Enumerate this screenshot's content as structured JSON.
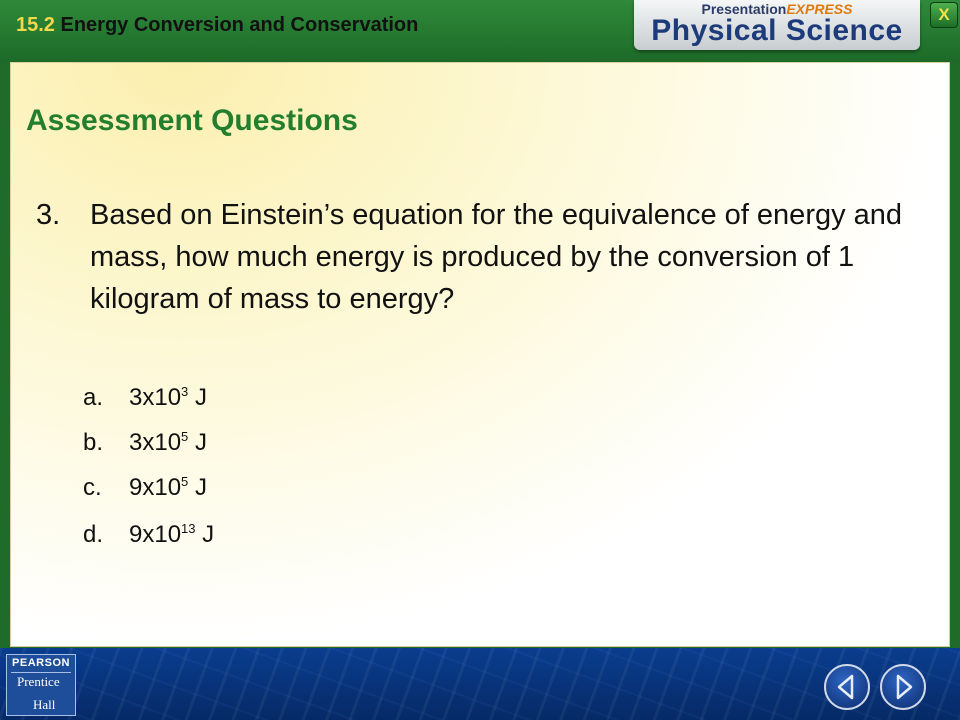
{
  "header": {
    "chapter_number": "15.2",
    "chapter_title": "Energy Conversion and Conservation",
    "brand_prefix": "Presentation",
    "brand_accent": "EXPRESS",
    "brand_main": "Physical Science",
    "close_label": "X"
  },
  "slide": {
    "title": "Assessment Questions",
    "question_number": "3.",
    "question_text": "Based on Einstein’s equation for the equivalence of energy and mass, how much energy is produced by the conversion of 1 kilogram of mass to energy?",
    "answers": [
      {
        "letter": "a.",
        "base": "3x10",
        "exp": "3",
        "unit": " J"
      },
      {
        "letter": "b.",
        "base": "3x10",
        "exp": "5",
        "unit": " J"
      },
      {
        "letter": "c.",
        "base": "9x10",
        "exp": "5",
        "unit": " J"
      },
      {
        "letter": "d.",
        "base": "9x10",
        "exp": "13",
        "unit": " J"
      }
    ]
  },
  "footer": {
    "logo_top": "PEARSON",
    "logo_mid": "Prentice",
    "logo_bot": "Hall",
    "prev_icon": "chevron-left-icon",
    "next_icon": "chevron-right-icon"
  },
  "colors": {
    "header_green": "#1d6a28",
    "title_green": "#237e2e",
    "chapter_number": "#f6d84a",
    "footer_blue": "#0a3d8f"
  }
}
